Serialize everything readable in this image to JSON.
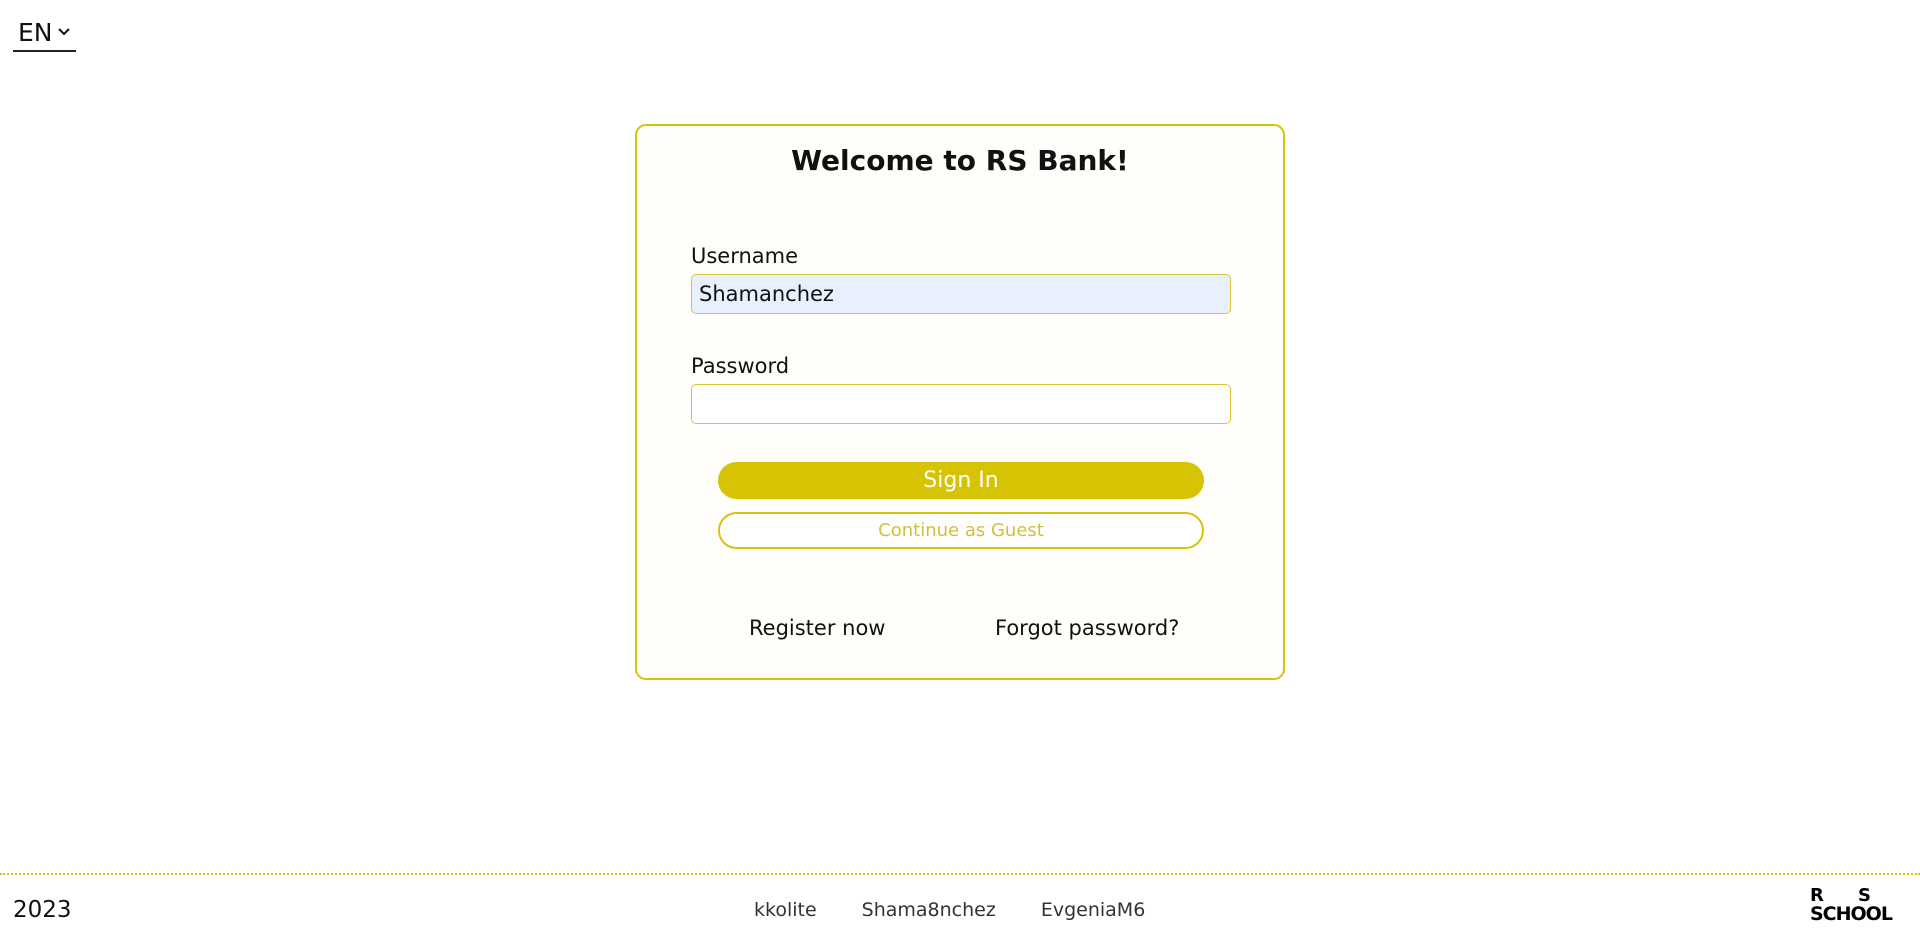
{
  "language": {
    "value": "EN",
    "chevron_icon": "chevron-down-icon"
  },
  "login": {
    "title": "Welcome to RS Bank!",
    "username_label": "Username",
    "username_value": "Shamanchez",
    "password_label": "Password",
    "password_value": "",
    "sign_in_label": "Sign In",
    "guest_label": "Continue as Guest",
    "register_label": "Register now",
    "forgot_label": "Forgot password?"
  },
  "footer": {
    "year": "2023",
    "authors": [
      "kkolite",
      "Shama8nchez",
      "EvgeniaM6"
    ],
    "logo": {
      "r": "R",
      "s": "S",
      "school": "SCHOOL"
    }
  },
  "colors": {
    "accent": "#d6c304",
    "autofill_bg": "#e8f0fe"
  }
}
